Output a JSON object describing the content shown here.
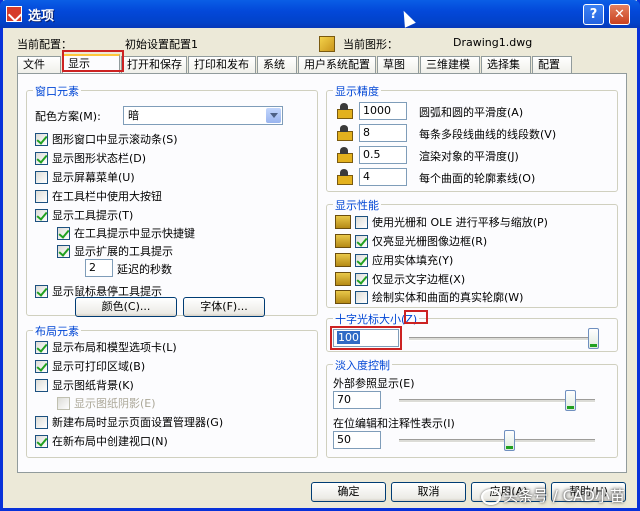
{
  "window": {
    "title": "选项",
    "help_glyph": "?",
    "close_glyph": "✕"
  },
  "header": {
    "current_profile_label": "当前配置：",
    "current_profile_value": "初始设置配置1",
    "current_drawing_label": "当前图形：",
    "current_drawing_value": "Drawing1.dwg"
  },
  "tabs": [
    {
      "label": "文件",
      "active": false
    },
    {
      "label": "显示",
      "active": true
    },
    {
      "label": "打开和保存",
      "active": false
    },
    {
      "label": "打印和发布",
      "active": false
    },
    {
      "label": "系统",
      "active": false
    },
    {
      "label": "用户系统配置",
      "active": false
    },
    {
      "label": "草图",
      "active": false
    },
    {
      "label": "三维建模",
      "active": false
    },
    {
      "label": "选择集",
      "active": false
    },
    {
      "label": "配置",
      "active": false
    }
  ],
  "window_elements": {
    "title": "窗口元素",
    "color_scheme_label": "配色方案(M):",
    "color_scheme_value": "暗",
    "items": [
      {
        "label": "图形窗口中显示滚动条(S)",
        "checked": true
      },
      {
        "label": "显示图形状态栏(D)",
        "checked": true
      },
      {
        "label": "显示屏幕菜单(U)",
        "checked": false
      },
      {
        "label": "在工具栏中使用大按钮",
        "checked": false
      },
      {
        "label": "显示工具提示(T)",
        "checked": true
      },
      {
        "label": "在工具提示中显示快捷键",
        "checked": true
      },
      {
        "label": "显示扩展的工具提示",
        "checked": true
      }
    ],
    "delay_value": "2",
    "delay_label": "延迟的秒数",
    "rollover_label": "显示鼠标悬停工具提示",
    "rollover_checked": true,
    "colors_button": "颜色(C)...",
    "fonts_button": "字体(F)..."
  },
  "layout_elements": {
    "title": "布局元素",
    "items": [
      {
        "label": "显示布局和模型选项卡(L)",
        "checked": true,
        "disabled": false
      },
      {
        "label": "显示可打印区域(B)",
        "checked": true,
        "disabled": false
      },
      {
        "label": "显示图纸背景(K)",
        "checked": false,
        "disabled": false
      },
      {
        "label": "显示图纸阴影(E)",
        "checked": false,
        "disabled": true
      },
      {
        "label": "新建布局时显示页面设置管理器(G)",
        "checked": false,
        "disabled": false
      },
      {
        "label": "在新布局中创建视口(N)",
        "checked": true,
        "disabled": false
      }
    ]
  },
  "display_resolution": {
    "title": "显示精度",
    "items": [
      {
        "value": "1000",
        "label": "圆弧和圆的平滑度(A)"
      },
      {
        "value": "8",
        "label": "每条多段线曲线的线段数(V)"
      },
      {
        "value": "0.5",
        "label": "渲染对象的平滑度(J)"
      },
      {
        "value": "4",
        "label": "每个曲面的轮廓素线(O)"
      }
    ]
  },
  "display_performance": {
    "title": "显示性能",
    "items": [
      {
        "label": "使用光栅和 OLE 进行平移与缩放(P)",
        "checked": false,
        "icon": true
      },
      {
        "label": "仅亮显光栅图像边框(R)",
        "checked": true,
        "icon": true
      },
      {
        "label": "应用实体填充(Y)",
        "checked": true,
        "icon": true
      },
      {
        "label": "仅显示文字边框(X)",
        "checked": true,
        "icon": true
      },
      {
        "label": "绘制实体和曲面的真实轮廓(W)",
        "checked": false,
        "icon": true
      }
    ]
  },
  "crosshair": {
    "title": "十字光标大小",
    "shortcut": "(Z)",
    "value": "100",
    "slider_fraction": 1.0
  },
  "fade_control": {
    "title": "淡入度控制",
    "xref_label": "外部参照显示(E)",
    "xref_value": "70",
    "xref_slider_fraction": 0.87,
    "inplace_label": "在位编辑和注释性表示(I)",
    "inplace_value": "50",
    "inplace_slider_fraction": 0.56
  },
  "buttons": {
    "ok": "确定",
    "cancel": "取消",
    "apply": "应用(A)",
    "help": "帮助(H)"
  },
  "watermark": {
    "text": "头条号 / CAD小苗"
  }
}
